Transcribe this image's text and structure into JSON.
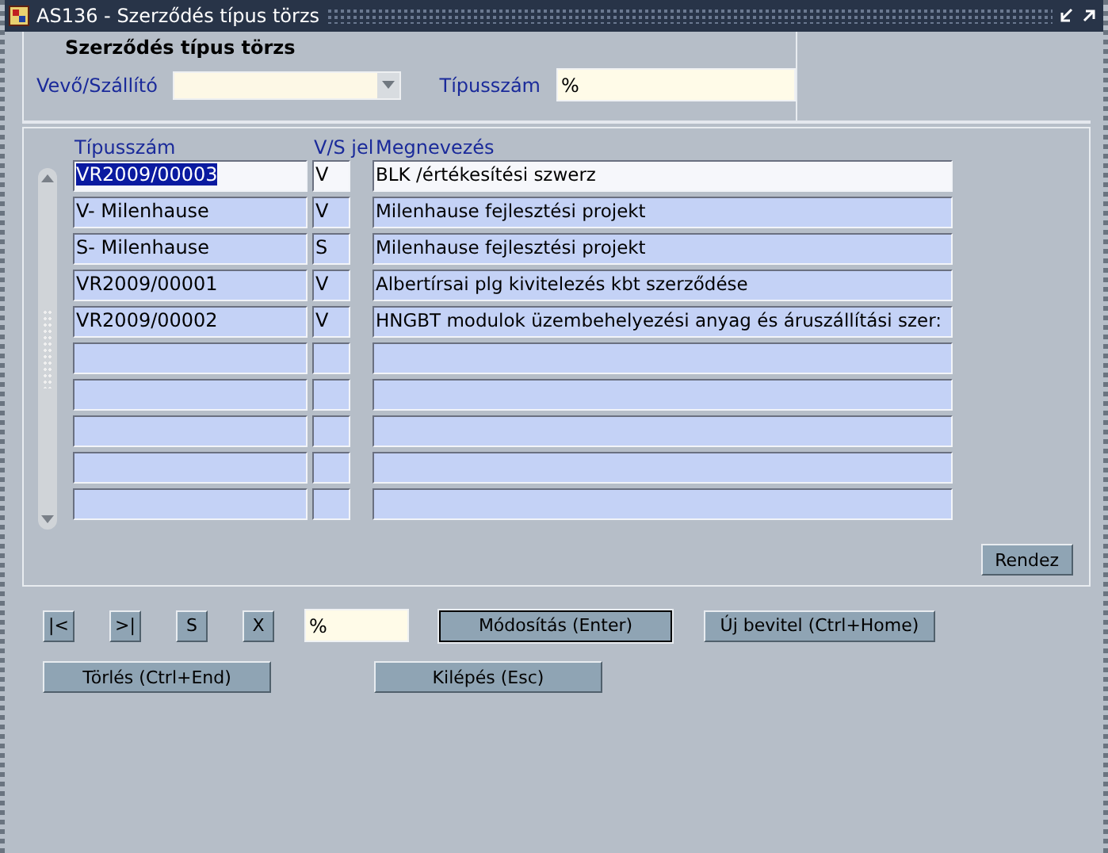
{
  "window": {
    "title": "AS136 - Szerződés típus törzs"
  },
  "header": {
    "title": "Szerződés típus törzs",
    "fields": [
      {
        "label": "Vevő/Szállító",
        "kind": "dropdown"
      },
      {
        "label": "Típusszám",
        "kind": "text",
        "value": "%"
      }
    ]
  },
  "table": {
    "columns": [
      "Típusszám",
      "V/S jel",
      "Megnevezés"
    ],
    "rows": [
      {
        "selected": true,
        "cells": [
          "VR2009/00003",
          "V",
          "BLK /értékesítési szwerz"
        ]
      },
      {
        "selected": false,
        "cells": [
          "V- Milenhause",
          "V",
          "Milenhause fejlesztési projekt"
        ]
      },
      {
        "selected": false,
        "cells": [
          "S- Milenhause",
          "S",
          "Milenhause fejlesztési projekt"
        ]
      },
      {
        "selected": false,
        "cells": [
          "VR2009/00001",
          "V",
          "Albertírsai plg kivitelezés  kbt szerződése"
        ]
      },
      {
        "selected": false,
        "cells": [
          "VR2009/00002",
          "V",
          "HNGBT modulok üzembehelyezési anyag és áruszállítási szer:"
        ]
      }
    ],
    "sort_button": "Rendez"
  },
  "toolbar": {
    "nav_buttons": [
      "|<",
      ">|",
      "S",
      "X"
    ],
    "filter": {
      "value": "%"
    },
    "buttons": [
      {
        "label": "Módosítás (Enter)",
        "default": true
      },
      {
        "label": "Új bevitel (Ctrl+Home)",
        "default": false
      }
    ]
  },
  "bottom_buttons": [
    "Törlés (Ctrl+End)",
    "Kilépés (Esc)"
  ]
}
